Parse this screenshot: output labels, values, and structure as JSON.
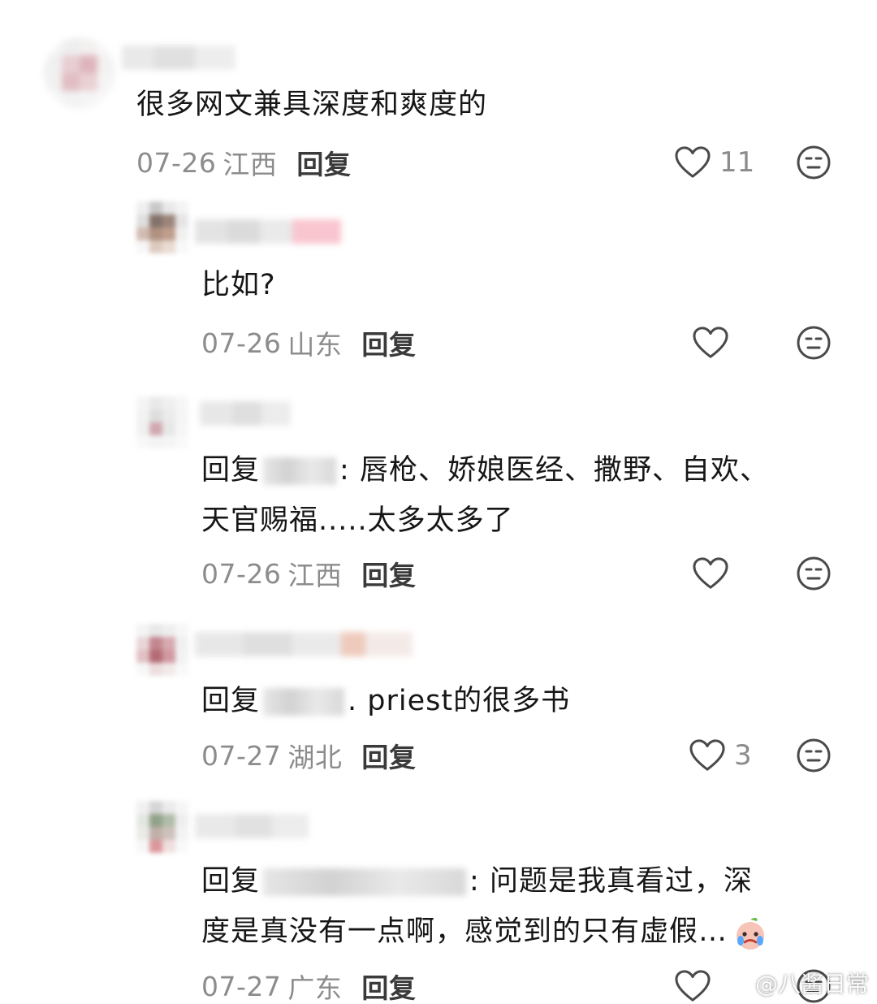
{
  "reply_label": "回复",
  "comments": [
    {
      "text": "很多网文兼具深度和爽度的",
      "date": "07-26",
      "region": "江西",
      "likes": "11"
    },
    {
      "text": "比如?",
      "date": "07-26",
      "region": "山东",
      "likes": ""
    },
    {
      "prefix": "回复",
      "colon": ":",
      "text_line1": "唇枪、娇娘医经、撒野、自欢、",
      "text_line2": "天官赐福.....太多太多了",
      "date": "07-26",
      "region": "江西",
      "likes": ""
    },
    {
      "prefix": "回复",
      "colon": ".",
      "text_line1": "priest的很多书",
      "date": "07-27",
      "region": "湖北",
      "likes": "3"
    },
    {
      "prefix": "回复",
      "colon": ":",
      "text_line1": "问题是我真看过，深",
      "text_line2": "度是真没有一点啊，感觉到的只有虚假…",
      "date": "07-27",
      "region": "广东",
      "likes": ""
    }
  ],
  "watermark": "@八酱日常",
  "icons": {
    "like": "heart-outline-icon",
    "dislike": "meh-face-icon",
    "emoji": "crying-peach-emoji-icon",
    "watermark": "weibo-logo-icon"
  },
  "colors": {
    "text": "#161616",
    "meta": "#8c8c8c",
    "icon": "#4a4a4a"
  }
}
